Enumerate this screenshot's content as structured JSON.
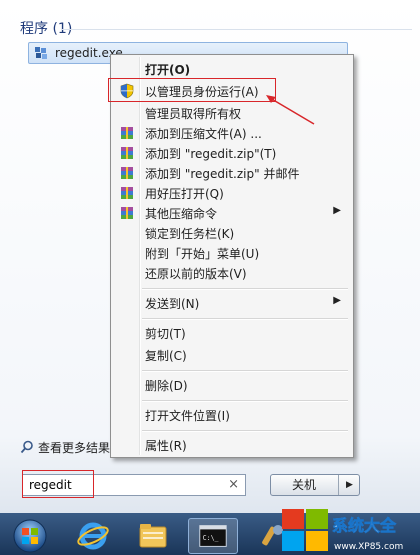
{
  "start_menu": {
    "programs_header": "程序 (1)",
    "result_item": {
      "label": "regedit.exe",
      "icon": "regedit-icon"
    },
    "more_results": "查看更多结果"
  },
  "context_menu": {
    "items": [
      {
        "label": "打开(O)",
        "bold": true
      },
      {
        "label": "以管理员身份运行(A)",
        "icon": "uac-shield-icon",
        "highlighted": true
      },
      {
        "label": "管理员取得所有权"
      },
      {
        "label": "添加到压缩文件(A) ...",
        "icon": "winrar-icon"
      },
      {
        "label": "添加到 \"regedit.zip\"(T)",
        "icon": "winrar-icon"
      },
      {
        "label": "添加到 \"regedit.zip\" 并邮件",
        "icon": "winrar-icon"
      },
      {
        "label": "用好压打开(Q)",
        "icon": "winrar-icon"
      },
      {
        "label": "其他压缩命令",
        "icon": "winrar-icon",
        "submenu": true
      },
      {
        "label": "锁定到任务栏(K)"
      },
      {
        "label": "附到「开始」菜单(U)"
      },
      {
        "label": "还原以前的版本(V)"
      },
      {
        "label": "发送到(N)",
        "submenu": true
      },
      {
        "label": "剪切(T)"
      },
      {
        "label": "复制(C)"
      },
      {
        "label": "删除(D)"
      },
      {
        "label": "打开文件位置(I)"
      },
      {
        "label": "属性(R)"
      }
    ]
  },
  "search": {
    "value": "regedit",
    "clear_glyph": "×"
  },
  "shutdown": {
    "label": "关机",
    "arrow_glyph": "▶"
  },
  "submenu_glyph": "▶",
  "taskbar": {
    "buttons": [
      "start-orb",
      "internet-explorer-icon",
      "file-explorer-icon",
      "command-prompt-icon",
      "tool-icon"
    ]
  },
  "brand": {
    "name": "系统大全",
    "url": "www.XP85.com"
  },
  "colors": {
    "highlight_red": "#d8262a",
    "accent_blue": "#1f3a7a"
  }
}
